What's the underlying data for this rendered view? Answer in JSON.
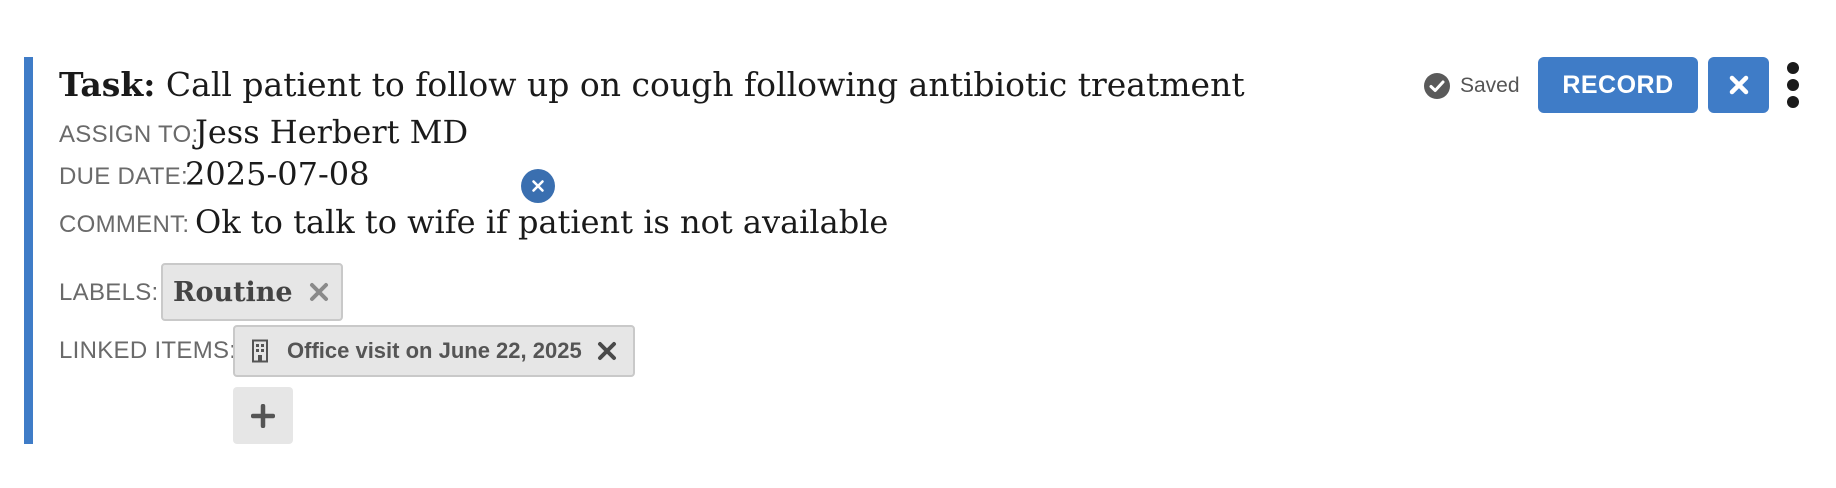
{
  "task": {
    "prefix": "Task:",
    "title": "Call patient to follow up on cough following antibiotic treatment"
  },
  "status": {
    "saved_label": "Saved"
  },
  "buttons": {
    "record_label": "RECORD"
  },
  "fields": {
    "assign_to_label": "ASSIGN TO:",
    "assign_to_value": "Jess Herbert MD",
    "due_date_label": "DUE DATE:",
    "due_date_value": "2025-07-08",
    "comment_label": "COMMENT:",
    "comment_value": "Ok to talk to wife if patient is not available",
    "labels_label": "LABELS:",
    "labels": [
      "Routine"
    ],
    "linked_items_label": "LINKED ITEMS:",
    "linked_items": [
      "Office visit on June 22, 2025"
    ]
  },
  "icons": {
    "saved": "check-circle-icon",
    "close": "close-icon",
    "menu": "kebab-menu-icon",
    "date_clear": "clear-circle-icon",
    "label_remove": "close-icon",
    "linked_building": "building-icon",
    "linked_remove": "close-icon",
    "add": "plus-icon"
  },
  "colors": {
    "accent": "#3f7cc7",
    "chip_bg": "#e6e6e6"
  }
}
